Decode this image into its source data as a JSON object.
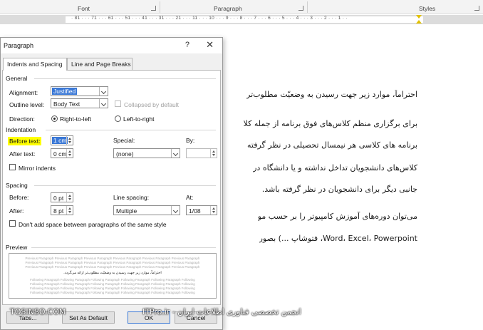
{
  "ribbon": {
    "groups": [
      "Font",
      "Paragraph",
      "Styles"
    ]
  },
  "ruler": {
    "numbers": "· 81 · · · 71 · · · 61 · · · 51 · · · 41 · · · 31 · · · 21 · · · 11 · · · 10 · · · 9 · · · 8 · · · 7 · · · 6 · · · 5 · · · 4 · · · 3 · · · 2 · · · 1 · ·"
  },
  "document": {
    "lines": [
      "احتراماً، موارد زیر جهت رسیدن به وضعیّت مطلوب‌تر",
      "برای برگزاری منظم کلاس‌های فوق برنامه از جمله کلا",
      "برنامه های کلاسی هر نیمسال تحصیلی در نظر گرفته",
      "کلاس‌های دانشجویان تداخل نداشته و یا دانشگاه در",
      "جانبی دیگر برای دانشجویان در نظر گرفته باشد.",
      "می‌توان دوره‌های آموزش کامپیوتر را بر حسب مو",
      "Word، Excel، Powerpoint، فتوشاپ ...) بصور"
    ]
  },
  "dialog": {
    "title": "Paragraph",
    "help": "?",
    "close": "✕",
    "tabs": [
      {
        "label": "Indents and Spacing",
        "underline": "I"
      },
      {
        "label": "Line and Page Breaks",
        "underline": "P"
      }
    ],
    "general": {
      "heading": "General",
      "alignment_label": "Alignment:",
      "alignment_value": "Justified",
      "outline_label": "Outline level:",
      "outline_value": "Body Text",
      "collapsed_label": "Collapsed by default",
      "direction_label": "Direction:",
      "rtl_label": "Right-to-left",
      "ltr_label": "Left-to-right"
    },
    "indentation": {
      "heading": "Indentation",
      "before_label": "Before text:",
      "before_value": "1 cm",
      "after_label": "After text:",
      "after_value": "0 cm",
      "special_label": "Special:",
      "special_value": "(none)",
      "by_label": "By:",
      "by_value": "",
      "mirror_label": "Mirror indents"
    },
    "spacing": {
      "heading": "Spacing",
      "before_label": "Before:",
      "before_value": "0 pt",
      "after_label": "After:",
      "after_value": "8 pt",
      "line_label": "Line spacing:",
      "line_value": "Multiple",
      "at_label": "At:",
      "at_value": "1/08",
      "dont_add_label": "Don't add space between paragraphs of the same style"
    },
    "preview": {
      "heading": "Preview",
      "prev_text": "Previous Paragraph Previous Paragraph Previous Paragraph Previous Paragraph Previous Paragraph Previous Paragraph",
      "sample_text": "احتراماً، موارد زیر جهت رسیدن به وضعیّت مطلوب‌تر ارائه می‌گردد.",
      "follow_text": "Following Paragraph Following Paragraph Following Paragraph Following Paragraph Following Paragraph Following"
    },
    "buttons": {
      "tabs": "Tabs...",
      "set_default": "Set As Default",
      "ok": "OK",
      "cancel": "Cancel"
    }
  },
  "watermark": {
    "left": "TOSINSO.COM",
    "right": "ITPro.ir - انجمن تخصصی فناوری اطلاعات ایران"
  },
  "colors": {
    "highlight": "#ffff00",
    "selection": "#3a78d6",
    "ruler_marker": "#e1c000"
  }
}
